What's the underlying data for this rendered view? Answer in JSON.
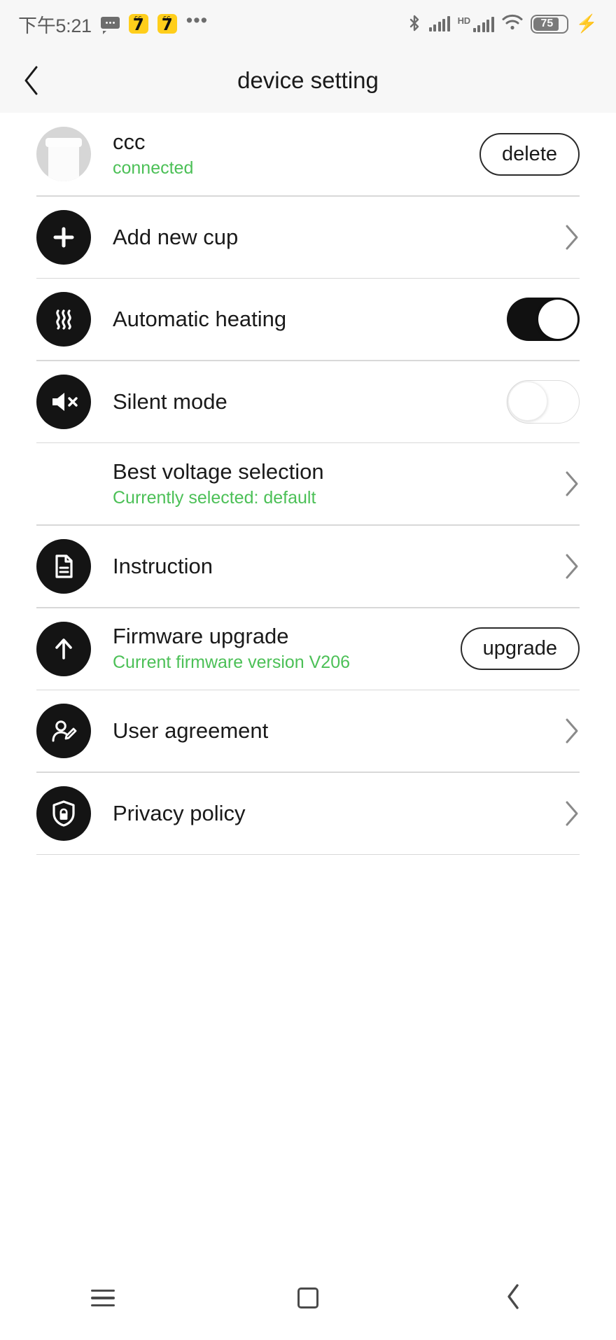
{
  "statusbar": {
    "time": "下午5:21",
    "messages_icon": "message-bubble-icon",
    "app_badge_1": "7",
    "app_badge_2": "7",
    "overflow": "•••",
    "bluetooth_icon": "bluetooth-icon",
    "signal_icon": "cellular-signal-icon",
    "hd_label": "HD",
    "signal2_icon": "cellular-signal-2-icon",
    "wifi_icon": "wifi-icon",
    "battery_percent": "75",
    "charging_icon": "⚡"
  },
  "header": {
    "back_icon": "back-chevron-icon",
    "title": "device setting"
  },
  "device": {
    "avatar_icon": "cup-avatar-icon",
    "name": "ccc",
    "status": "connected",
    "delete_label": "delete"
  },
  "rows": [
    {
      "id": "add-new-cup",
      "icon": "plus-icon",
      "title": "Add new cup",
      "subtitle": "",
      "accessory": "chevron"
    },
    {
      "id": "automatic-heating",
      "icon": "steam-waves-icon",
      "title": "Automatic heating",
      "subtitle": "",
      "accessory": "toggle-on"
    },
    {
      "id": "silent-mode",
      "icon": "speaker-mute-icon",
      "title": "Silent mode",
      "subtitle": "",
      "accessory": "toggle-off"
    },
    {
      "id": "best-voltage-selection",
      "icon": "",
      "title": "Best voltage selection",
      "subtitle": "Currently selected: default",
      "accessory": "chevron"
    },
    {
      "id": "instruction",
      "icon": "document-icon",
      "title": "Instruction",
      "subtitle": "",
      "accessory": "chevron"
    },
    {
      "id": "firmware-upgrade",
      "icon": "up-arrow-icon",
      "title": "Firmware upgrade",
      "subtitle": "Current firmware version V206",
      "accessory": "button",
      "button_label": "upgrade"
    },
    {
      "id": "user-agreement",
      "icon": "user-edit-icon",
      "title": "User agreement",
      "subtitle": "",
      "accessory": "chevron"
    },
    {
      "id": "privacy-policy",
      "icon": "shield-lock-icon",
      "title": "Privacy policy",
      "subtitle": "",
      "accessory": "chevron"
    }
  ],
  "navbar": {
    "menu_icon": "menu-icon",
    "home_icon": "home-square-icon",
    "back_icon": "nav-back-icon"
  },
  "colors": {
    "accent_green": "#4CC057",
    "icon_black": "#141414",
    "chrome_bg": "#f7f7f7"
  }
}
